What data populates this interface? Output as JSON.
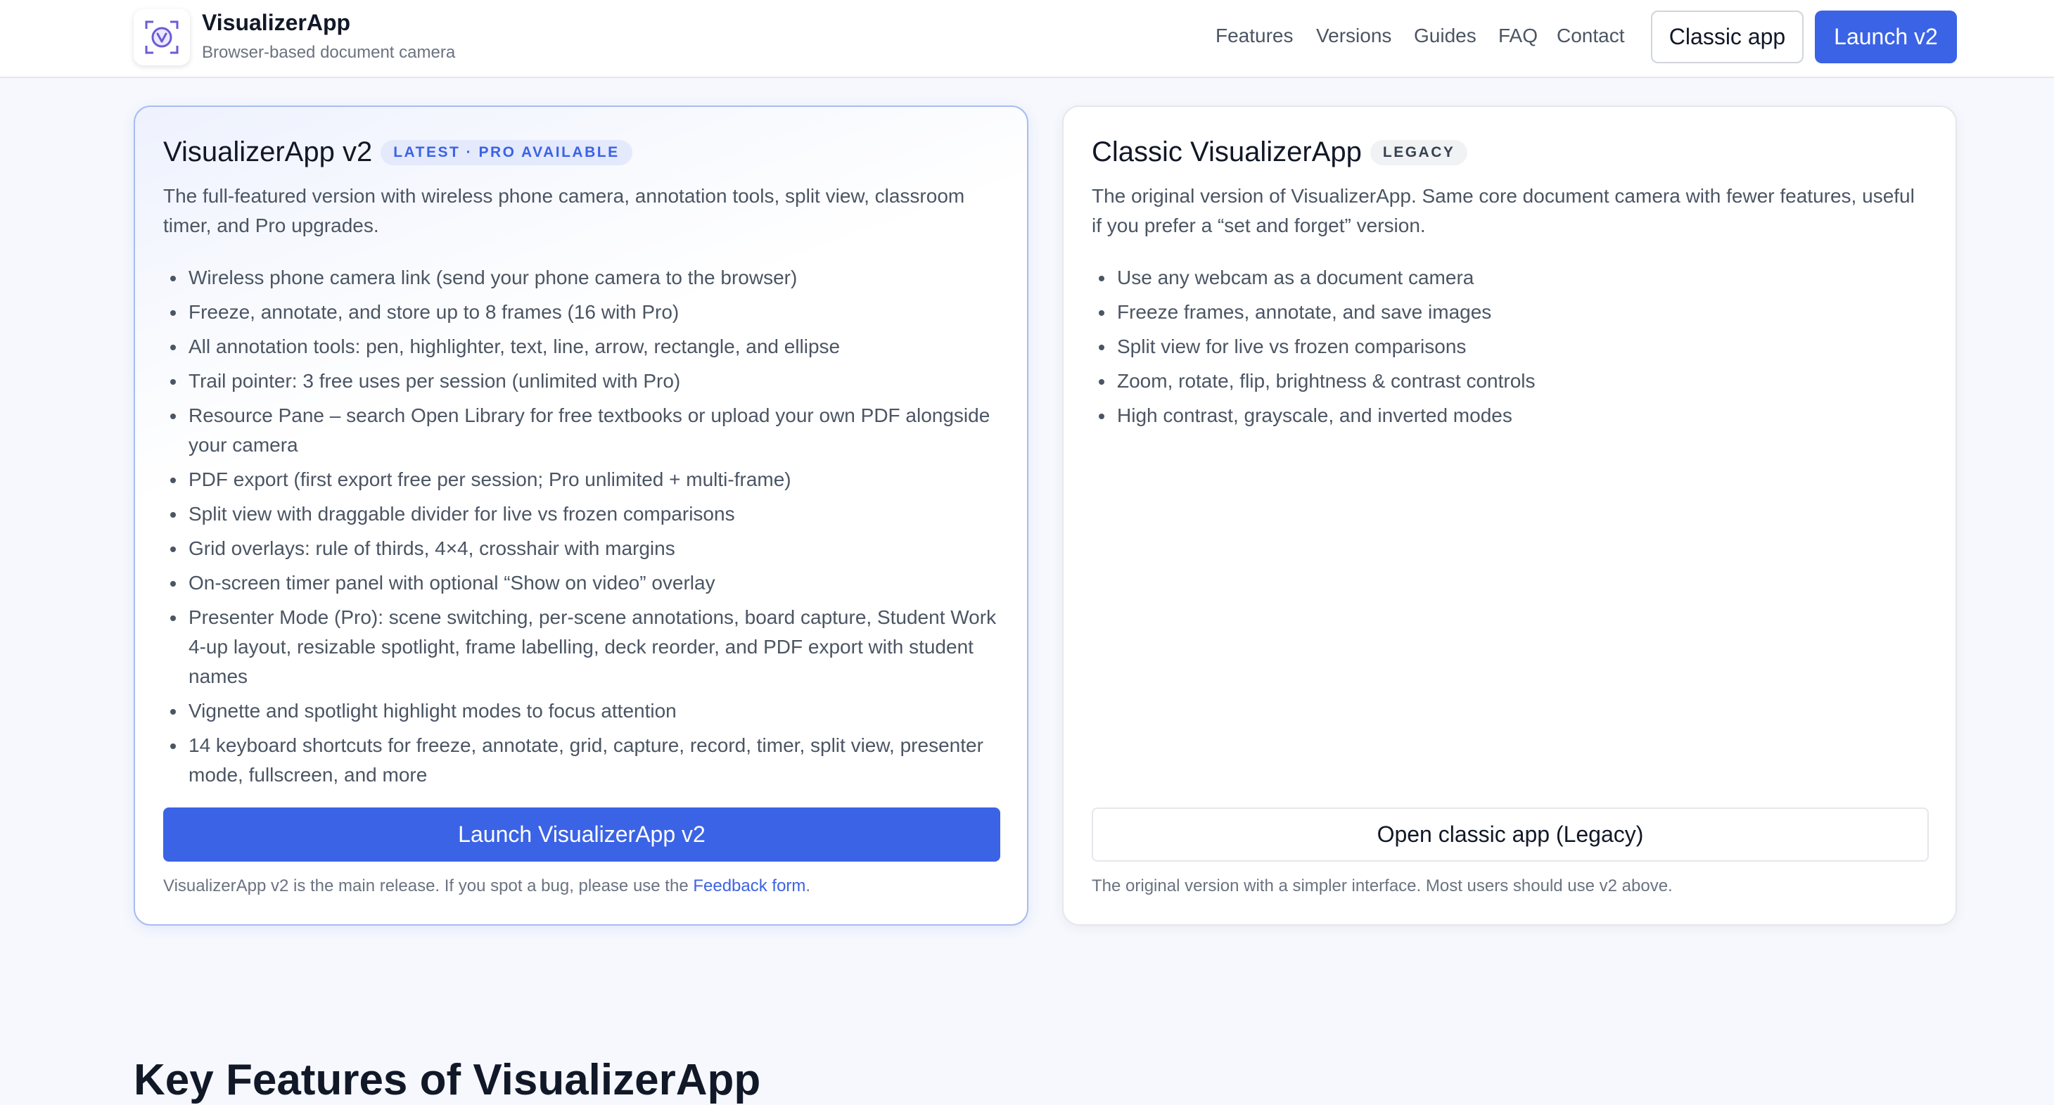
{
  "header": {
    "brand_name": "VisualizerApp",
    "brand_tagline": "Browser-based document camera",
    "nav": [
      "Features",
      "Versions",
      "Guides",
      "FAQ",
      "Contact"
    ],
    "classic_button": "Classic app",
    "launch_button": "Launch v2"
  },
  "v2_card": {
    "title": "VisualizerApp v2",
    "badge": "LATEST · PRO AVAILABLE",
    "description": "The full-featured version with wireless phone camera, annotation tools, split view, classroom timer, and Pro upgrades.",
    "features": [
      "Wireless phone camera link (send your phone camera to the browser)",
      "Freeze, annotate, and store up to 8 frames (16 with Pro)",
      "All annotation tools: pen, highlighter, text, line, arrow, rectangle, and ellipse",
      "Trail pointer: 3 free uses per session (unlimited with Pro)",
      "Resource Pane – search Open Library for free textbooks or upload your own PDF alongside your camera",
      "PDF export (first export free per session; Pro unlimited + multi-frame)",
      "Split view with draggable divider for live vs frozen comparisons",
      "Grid overlays: rule of thirds, 4×4, crosshair with margins",
      "On-screen timer panel with optional “Show on video” overlay",
      "Presenter Mode (Pro): scene switching, per-scene annotations, board capture, Student Work 4-up layout, resizable spotlight, frame labelling, deck reorder, and PDF export with student names",
      "Vignette and spotlight highlight modes to focus attention",
      "14 keyboard shortcuts for freeze, annotate, grid, capture, record, timer, split view, presenter mode, fullscreen, and more"
    ],
    "cta": "Launch VisualizerApp v2",
    "note_prefix": "VisualizerApp v2 is the main release. If you spot a bug, please use the ",
    "note_link": "Feedback form",
    "note_suffix": "."
  },
  "classic_card": {
    "title": "Classic VisualizerApp",
    "badge": "LEGACY",
    "description": "The original version of VisualizerApp. Same core document camera with fewer features, useful if you prefer a “set and forget” version.",
    "features": [
      "Use any webcam as a document camera",
      "Freeze frames, annotate, and save images",
      "Split view for live vs frozen comparisons",
      "Zoom, rotate, flip, brightness & contrast controls",
      "High contrast, grayscale, and inverted modes"
    ],
    "cta": "Open classic app (Legacy)",
    "note": "The original version with a simpler interface. Most users should use v2 above."
  },
  "section_heading": "Key Features of VisualizerApp",
  "colors": {
    "accent": "#3b63e5",
    "badge_pro_bg": "#e4eafc",
    "page_bg": "#f6f8fd"
  }
}
